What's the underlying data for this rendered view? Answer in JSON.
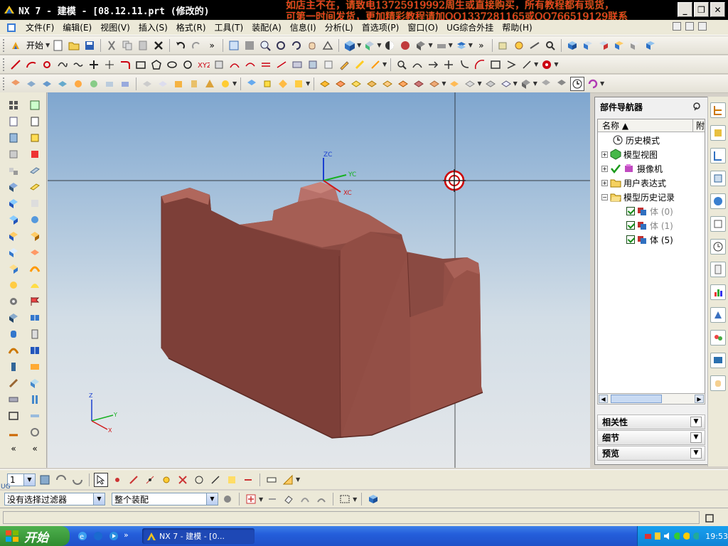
{
  "window": {
    "title": "NX 7 - 建模 - [08.12.11.prt  (修改的)",
    "promo_line1": "如店主不在，请致电13725919992周生或直接购买，所有教程都有现货，",
    "promo_line2": "可第一时间发货，更加精彩教程请加QQ1337281165或QQ766519129联系"
  },
  "menu": {
    "items": [
      "文件(F)",
      "编辑(E)",
      "视图(V)",
      "插入(S)",
      "格式(R)",
      "工具(T)",
      "装配(A)",
      "信息(I)",
      "分析(L)",
      "首选项(P)",
      "窗口(O)",
      "UG综合外挂",
      "帮助(H)"
    ]
  },
  "toolbar": {
    "start_label": "开始"
  },
  "navigator": {
    "title": "部件导航器",
    "col_name": "名称",
    "col_attach": "附",
    "rows": [
      {
        "label": "历史模式"
      },
      {
        "label": "模型视图"
      },
      {
        "label": "摄像机"
      },
      {
        "label": "用户表达式"
      },
      {
        "label": "模型历史记录"
      },
      {
        "label": "体 (0)"
      },
      {
        "label": "体 (1)"
      },
      {
        "label": "体 (5)"
      }
    ],
    "sections": [
      "相关性",
      "细节",
      "预览"
    ]
  },
  "viewport": {
    "axis_wcs": {
      "z": "ZC",
      "y": "YC",
      "x": "XC"
    },
    "axis_abs": {
      "z": "Z",
      "y": "Y",
      "x": "X"
    }
  },
  "bottom": {
    "layer_value": "1",
    "filter_value": "没有选择过滤器",
    "scope_value": "整个装配",
    "ug_label": "UG"
  },
  "taskbar": {
    "start": "开始",
    "task": "NX 7 - 建模 - [0...",
    "time": "19:53"
  }
}
